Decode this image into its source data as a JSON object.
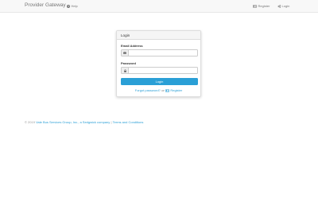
{
  "navbar": {
    "brand": "Provider Gateway",
    "help_label": "Help",
    "register_label": "Register",
    "login_label": "Login"
  },
  "login_panel": {
    "heading": "Login",
    "email_label": "Email Address",
    "email_value": "",
    "password_label": "Password",
    "password_value": "",
    "submit_label": "Login",
    "forgot_label": "Forgot password?",
    "or_label": "or",
    "register_label": "Register"
  },
  "footer": {
    "copyright": "© 2019",
    "company": "Vale Bus Services Group, Inc., a Sedgwick company",
    "separator": "|",
    "terms": "Terms and Conditions"
  },
  "colors": {
    "accent": "#2a9fd6",
    "navbar_bg": "#f8f8f8",
    "nav_text": "#777777"
  },
  "icons": {
    "help": "question-circle-icon",
    "register": "register-card-icon",
    "login": "sign-in-icon",
    "email": "envelope-icon",
    "password": "lock-icon"
  }
}
